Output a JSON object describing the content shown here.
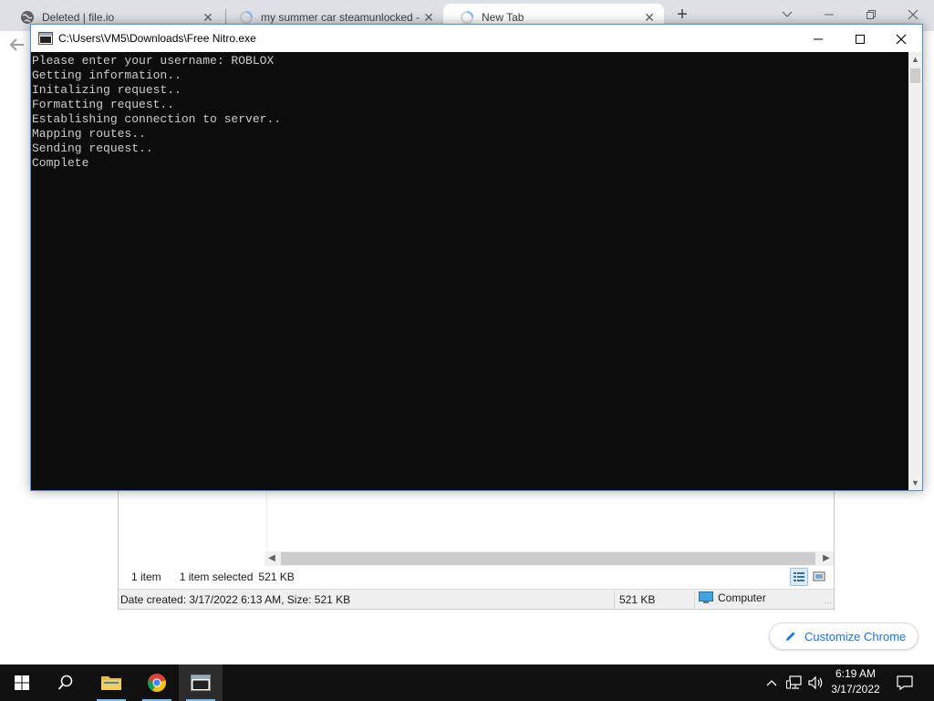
{
  "browser": {
    "tabs": [
      {
        "title": "Deleted | file.io",
        "icon": "globe-icon",
        "active": false
      },
      {
        "title": "my summer car steamunlocked -",
        "icon": "loading-icon",
        "active": false
      },
      {
        "title": "New Tab",
        "icon": "loading-icon",
        "active": true
      }
    ],
    "new_tab_label": "+",
    "close_glyph": "✕"
  },
  "explorer": {
    "item_count": "1 item",
    "selected": "1 item selected",
    "selected_size": "521 KB",
    "details_created": "Date created: 3/17/2022 6:13 AM, Size: 521 KB",
    "details_size": "521 KB",
    "details_location": "Computer"
  },
  "customize_chrome": {
    "label": "Customize Chrome"
  },
  "console": {
    "title": "C:\\Users\\VM5\\Downloads\\Free Nitro.exe",
    "lines": [
      "Please enter your username: ROBLOX",
      "Getting information..",
      "Initalizing request..",
      "Formatting request..",
      "Establishing connection to server..",
      "Mapping routes..",
      "Sending request..",
      "Complete"
    ]
  },
  "taskbar": {
    "apps": [
      "start-button",
      "search-icon",
      "file-explorer-icon",
      "chrome-icon",
      "console-app-icon"
    ],
    "clock_time": "6:19 AM",
    "clock_date": "3/17/2022"
  },
  "colors": {
    "console_bg": "#0c0c0c",
    "console_text": "#cccccc",
    "chrome_accent": "#1a73e8",
    "taskbar_bg": "#101010"
  }
}
